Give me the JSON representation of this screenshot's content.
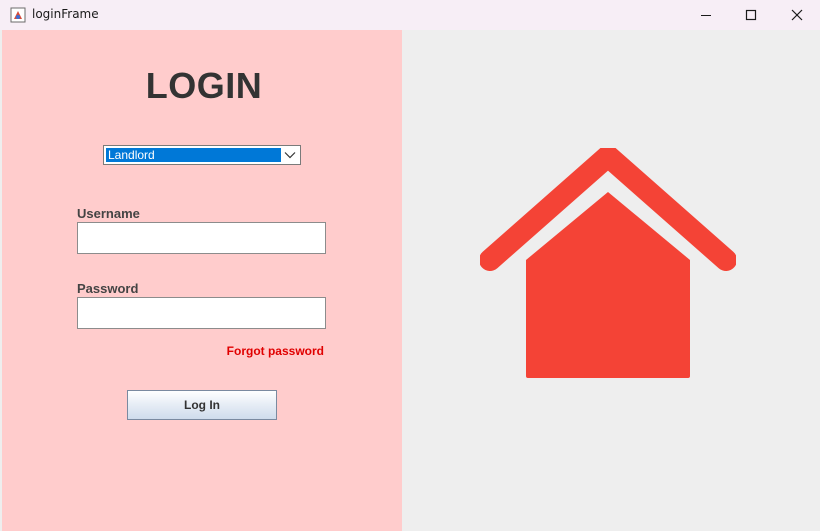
{
  "window": {
    "title": "loginFrame",
    "controls": {
      "minimize": "minimize-icon",
      "maximize": "maximize-icon",
      "close": "close-icon"
    }
  },
  "login": {
    "heading": "LOGIN",
    "role_select": {
      "selected": "Landlord"
    },
    "username": {
      "label": "Username",
      "value": ""
    },
    "password": {
      "label": "Password",
      "value": ""
    },
    "forgot_password": "Forgot password",
    "login_button": "Log In"
  },
  "illustration": {
    "icon": "house-icon",
    "color": "#f44336"
  },
  "colors": {
    "left_panel_bg": "#ffcccc",
    "right_panel_bg": "#eeeeee",
    "accent_red": "#f44336",
    "link_red": "#e00000",
    "select_highlight": "#0078d7"
  }
}
